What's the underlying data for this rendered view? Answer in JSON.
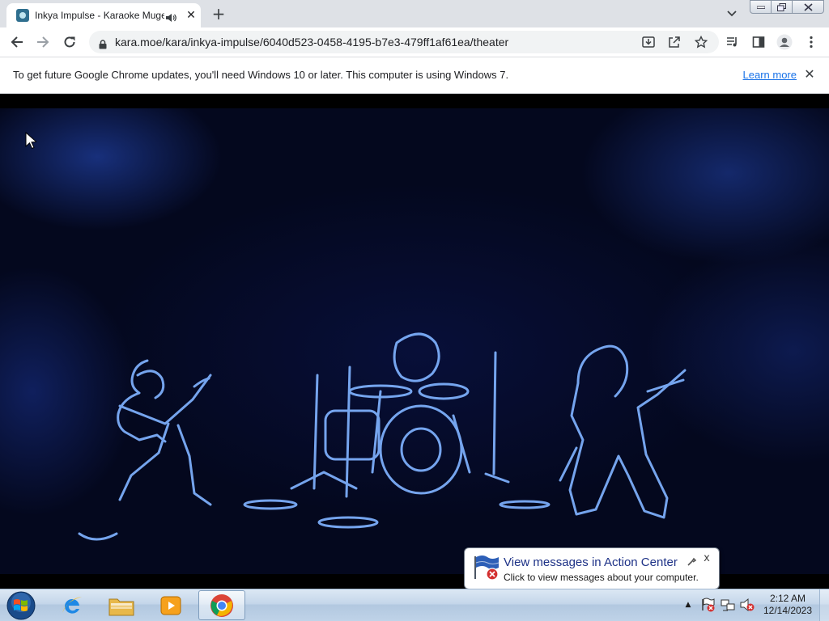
{
  "browser": {
    "tab": {
      "title": "Inkya Impulse - Karaoke Mugen",
      "favicon": "karaoke-favicon",
      "audio_icon": "speaker-icon",
      "close_glyph": "✕"
    },
    "new_tab_glyph": "+",
    "tab_search_glyph": "⌄",
    "url": "kara.moe/kara/inkya-impulse/6040d523-0458-4195-b7e3-479ff1af61ea/theater",
    "infobar": {
      "message": "To get future Google Chrome updates, you'll need Windows 10 or later. This computer is using Windows 7.",
      "link": "Learn more",
      "close_glyph": "✕"
    },
    "accent": "#1a73e8"
  },
  "notification": {
    "title": "View messages in Action Center",
    "text": "Click to view messages about your computer.",
    "close_glyph": "x"
  },
  "taskbar": {
    "apps": [
      "internet-explorer",
      "windows-explorer",
      "windows-media-player",
      "google-chrome"
    ],
    "tray_arrow": "▲",
    "clock_time": "2:12 AM",
    "clock_date": "12/14/2023"
  }
}
